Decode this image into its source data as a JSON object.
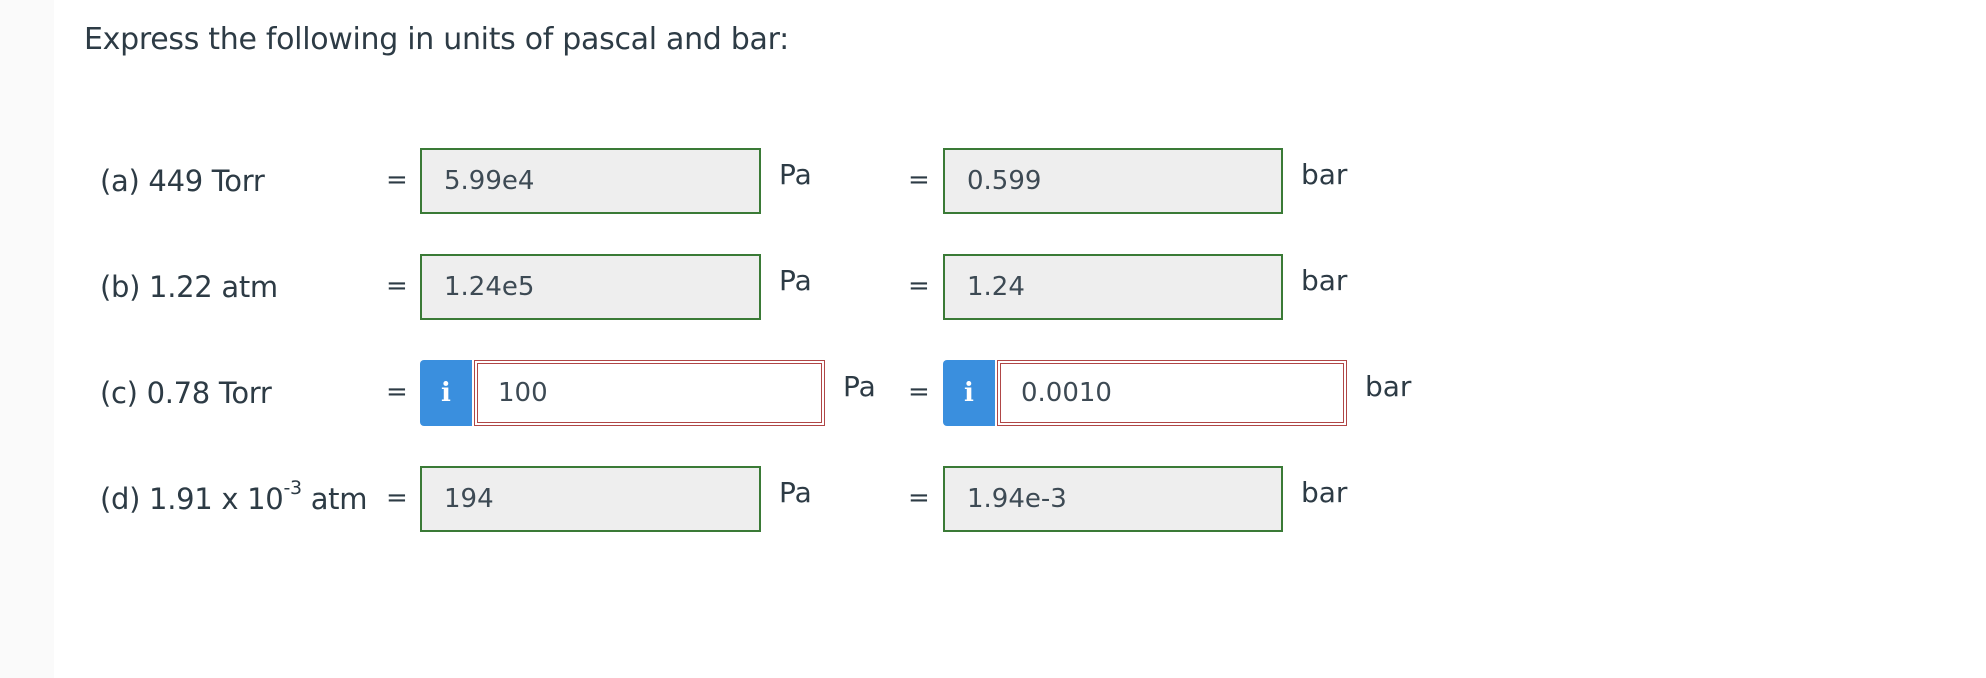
{
  "question": {
    "prompt": "Express the following in units of pascal and bar:"
  },
  "equals_sign": "=",
  "info_glyph": "i",
  "rows": [
    {
      "label": "(a) 449 Torr",
      "pa_value": "5.99e4",
      "pa_unit": "Pa",
      "bar_value": "0.599",
      "bar_unit": "bar",
      "status": "correct"
    },
    {
      "label": "(b) 1.22 atm",
      "pa_value": "1.24e5",
      "pa_unit": "Pa",
      "bar_value": "1.24",
      "bar_unit": "bar",
      "status": "correct"
    },
    {
      "label": "(c) 0.78 Torr",
      "pa_value": "100",
      "pa_unit": "Pa",
      "bar_value": "0.0010",
      "bar_unit": "bar",
      "status": "incorrect"
    },
    {
      "label_prefix": "(d) 1.91 x 10",
      "label_exponent": "-3",
      "label_suffix": " atm",
      "pa_value": "194",
      "pa_unit": "Pa",
      "bar_value": "1.94e-3",
      "bar_unit": "bar",
      "status": "correct"
    }
  ],
  "colors": {
    "correct_border": "#3a7a36",
    "incorrect_border": "#b04646",
    "info_button": "#3a8fde",
    "text": "#2d3b45",
    "field_background": "#eeeeee"
  }
}
